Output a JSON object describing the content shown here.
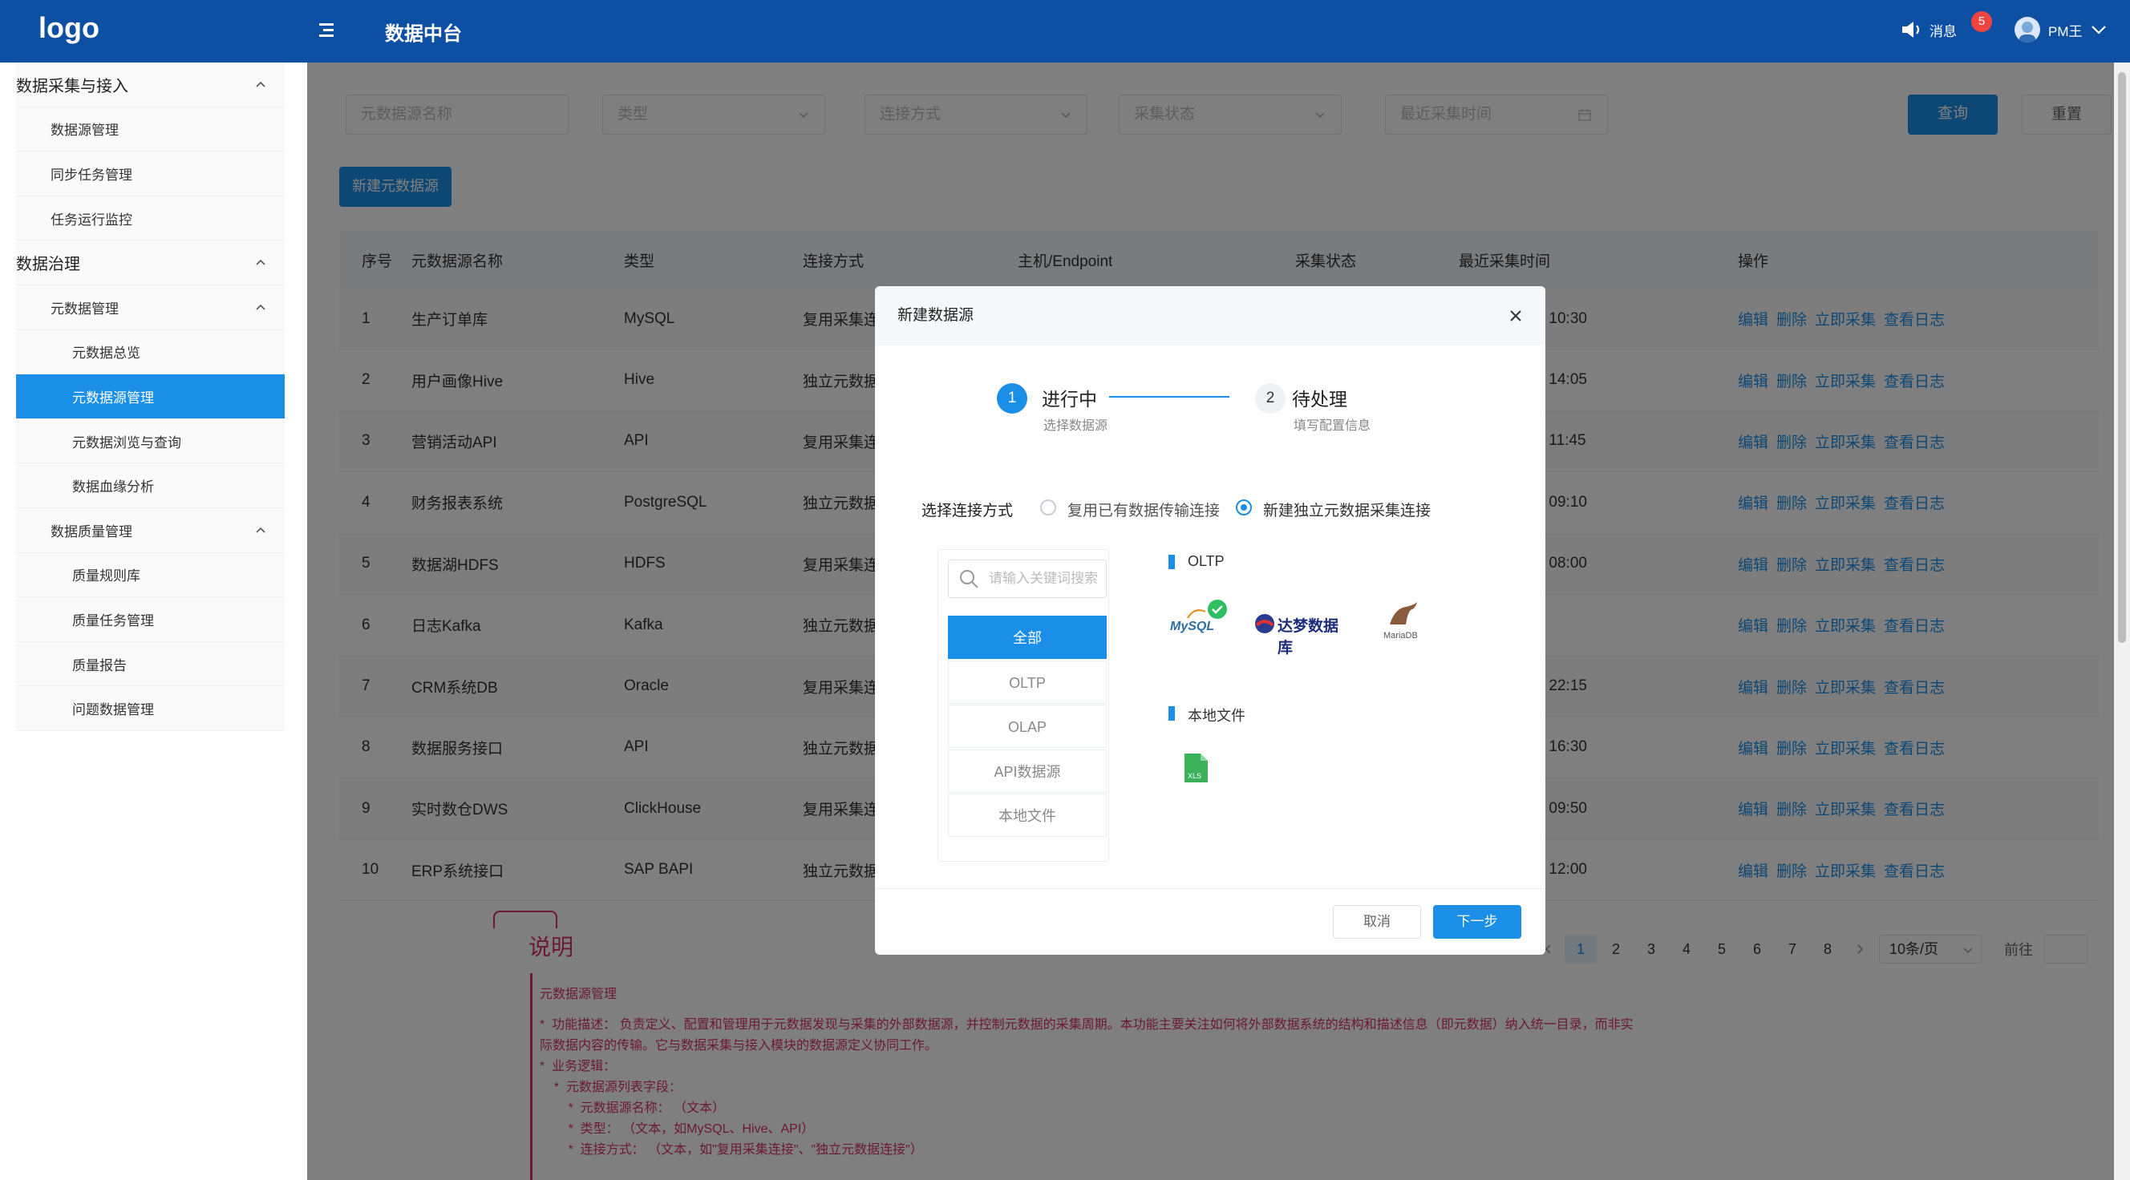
{
  "header": {
    "logo": "logo",
    "title": "数据中台",
    "messages_label": "消息",
    "messages_count": "5",
    "user_name": "PM王"
  },
  "sidebar": {
    "items": [
      {
        "label": "数据采集与接入",
        "level": "group",
        "expanded": true
      },
      {
        "label": "数据源管理",
        "level": "lvl1"
      },
      {
        "label": "同步任务管理",
        "level": "lvl1"
      },
      {
        "label": "任务运行监控",
        "level": "lvl1"
      },
      {
        "label": "数据治理",
        "level": "group",
        "expanded": true
      },
      {
        "label": "元数据管理",
        "level": "lvl1",
        "expanded": true
      },
      {
        "label": "元数据总览",
        "level": "lvl2"
      },
      {
        "label": "元数据源管理",
        "level": "lvl2",
        "active": true
      },
      {
        "label": "元数据浏览与查询",
        "level": "lvl2"
      },
      {
        "label": "数据血缘分析",
        "level": "lvl2"
      },
      {
        "label": "数据质量管理",
        "level": "lvl1",
        "expanded": true
      },
      {
        "label": "质量规则库",
        "level": "lvl2"
      },
      {
        "label": "质量任务管理",
        "level": "lvl2"
      },
      {
        "label": "质量报告",
        "level": "lvl2"
      },
      {
        "label": "问题数据管理",
        "level": "lvl2"
      }
    ]
  },
  "filters": {
    "name_placeholder": "元数据源名称",
    "type_placeholder": "类型",
    "conn_placeholder": "连接方式",
    "status_placeholder": "采集状态",
    "time_placeholder": "最近采集时间",
    "query_label": "查询",
    "reset_label": "重置"
  },
  "new_button_label": "新建元数据源",
  "table": {
    "headers": [
      "序号",
      "元数据源名称",
      "类型",
      "连接方式",
      "主机/Endpoint",
      "采集状态",
      "最近采集时间",
      "操作"
    ],
    "rows": [
      {
        "no": "1",
        "name": "生产订单库",
        "type": "MySQL",
        "conn": "复用采集连",
        "time": "27 10:30"
      },
      {
        "no": "2",
        "name": "用户画像Hive",
        "type": "Hive",
        "conn": "独立元数据",
        "time": "26 14:05"
      },
      {
        "no": "3",
        "name": "营销活动API",
        "type": "API",
        "conn": "复用采集连",
        "time": "27 11:45"
      },
      {
        "no": "4",
        "name": "财务报表系统",
        "type": "PostgreSQL",
        "conn": "独立元数据",
        "time": "25 09:10"
      },
      {
        "no": "5",
        "name": "数据湖HDFS",
        "type": "HDFS",
        "conn": "复用采集连",
        "time": "27 08:00"
      },
      {
        "no": "6",
        "name": "日志Kafka",
        "type": "Kafka",
        "conn": "独立元数据",
        "time": ""
      },
      {
        "no": "7",
        "name": "CRM系统DB",
        "type": "Oracle",
        "conn": "复用采集连",
        "time": "26 22:15"
      },
      {
        "no": "8",
        "name": "数据服务接口",
        "type": "API",
        "conn": "独立元数据",
        "time": "24 16:30"
      },
      {
        "no": "9",
        "name": "实时数仓DWS",
        "type": "ClickHouse",
        "conn": "复用采集连",
        "time": "27 09:50"
      },
      {
        "no": "10",
        "name": "ERP系统接口",
        "type": "SAP BAPI",
        "conn": "独立元数据",
        "time": "27 12:00"
      }
    ],
    "ops": [
      "编辑",
      "删除",
      "立即采集",
      "查看日志"
    ]
  },
  "pagination": {
    "pages": [
      "1",
      "2",
      "3",
      "4",
      "5",
      "6",
      "7",
      "8"
    ],
    "current": "1",
    "page_size": "10条/页",
    "goto_label": "前往"
  },
  "note": {
    "title": "说明",
    "lines": [
      "元数据源管理",
      "*  功能描述： 负责定义、配置和管理用于元数据发现与采集的外部数据源，并控制元数据的采集周期。本功能主要关注如何将外部数据系统的结构和描述信息（即元数据）纳入统一目录，而非实",
      "际数据内容的传输。它与数据采集与接入模块的数据源定义协同工作。",
      "*  业务逻辑：",
      "    *  元数据源列表字段：",
      "        *  元数据源名称： （文本）",
      "        *  类型： （文本，如MySQL、Hive、API）",
      "        *  连接方式： （文本，如\"复用采集连接\"、\"独立元数据连接\"）"
    ]
  },
  "modal": {
    "title": "新建数据源",
    "step1_num": "1",
    "step1_title": "进行中",
    "step1_sub": "选择数据源",
    "step2_num": "2",
    "step2_title": "待处理",
    "step2_sub": "填写配置信息",
    "conn_label": "选择连接方式",
    "radio1_label": "复用已有数据传输连接",
    "radio2_label": "新建独立元数据采集连接",
    "search_placeholder": "请输入关键词搜索",
    "categories": [
      "全部",
      "OLTP",
      "OLAP",
      "API数据源",
      "本地文件"
    ],
    "section_oltp": "OLTP",
    "section_file": "本地文件",
    "logo_mysql": "MySQL",
    "logo_dameng": "达梦数据库",
    "logo_mariadb": "MariaDB",
    "file_xls": "XLS",
    "cancel_label": "取消",
    "next_label": "下一步"
  },
  "colors": {
    "brand": "#0d4fa3",
    "primary": "#1b8ee8",
    "note": "#d6336c"
  }
}
